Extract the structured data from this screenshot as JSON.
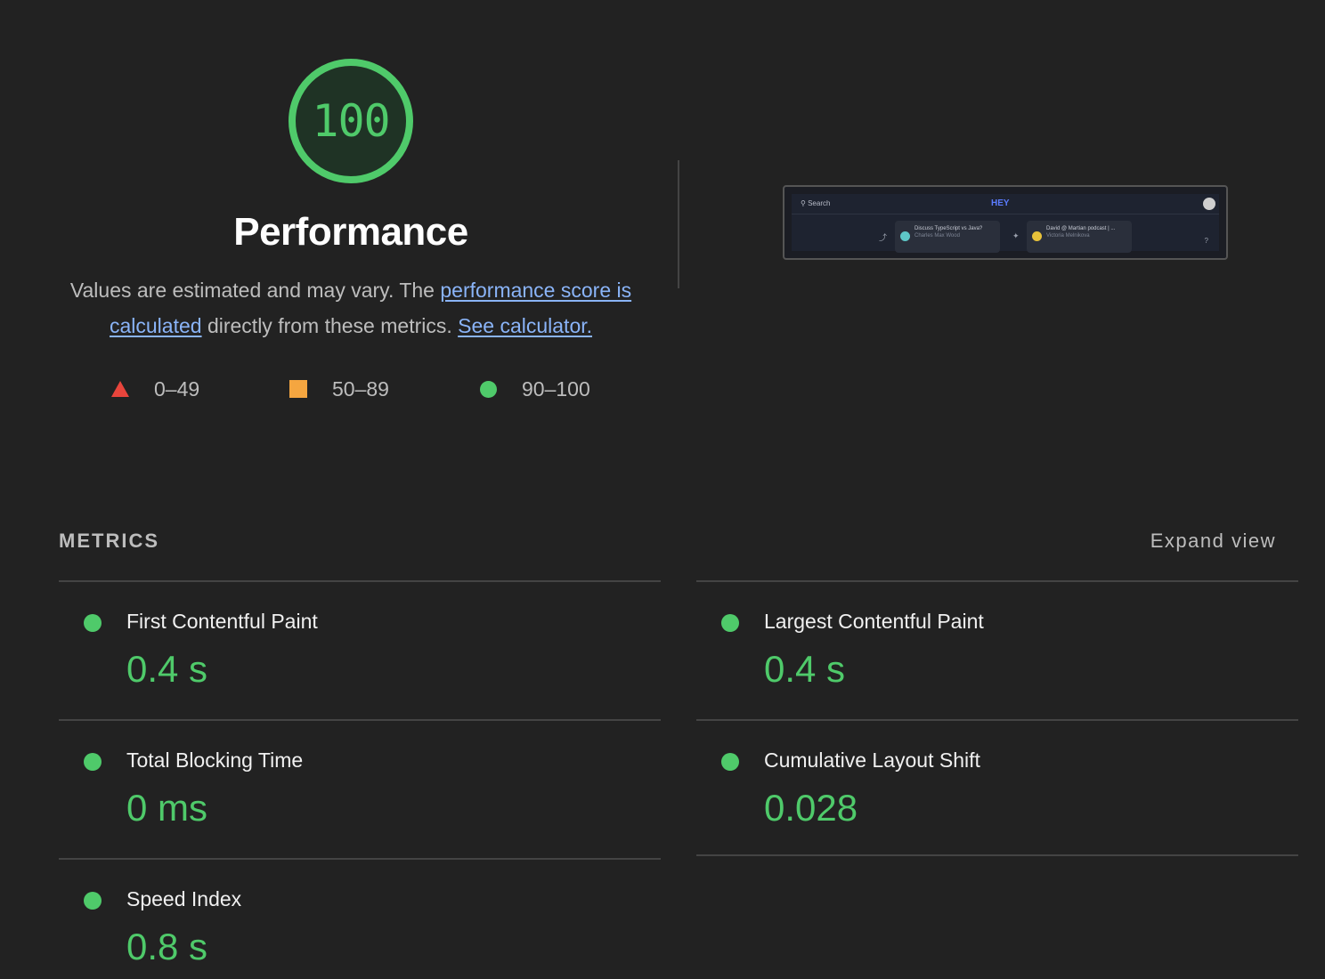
{
  "gauge": {
    "score": "100",
    "score_fraction": 1.0,
    "color": "#4fca6a"
  },
  "category": {
    "title": "Performance"
  },
  "description": {
    "text_1": "Values are estimated and may vary. The ",
    "link_1": "performance score is calculated",
    "text_2": " directly from these metrics. ",
    "link_2": "See calculator."
  },
  "legend": [
    {
      "range": "0–49",
      "shape": "triangle",
      "color": "#e8453c"
    },
    {
      "range": "50–89",
      "shape": "square",
      "color": "#f5a640"
    },
    {
      "range": "90–100",
      "shape": "circle",
      "color": "#4fca6a"
    }
  ],
  "thumbnail": {
    "search_label": "Search",
    "logo": "HEY",
    "card_1_title": "Discuss TypeScript vs Java?",
    "card_1_sub": "Charles Max Wood",
    "card_2_title": "David @ Martian podcast | ...",
    "card_2_sub": "Victoria Melnikova",
    "help": "?"
  },
  "metrics": {
    "header": "METRICS",
    "expand_label": "Expand view",
    "items": [
      {
        "title": "First Contentful Paint",
        "value": "0.4 s",
        "status": "pass"
      },
      {
        "title": "Largest Contentful Paint",
        "value": "0.4 s",
        "status": "pass"
      },
      {
        "title": "Total Blocking Time",
        "value": "0 ms",
        "status": "pass"
      },
      {
        "title": "Cumulative Layout Shift",
        "value": "0.028",
        "status": "pass"
      },
      {
        "title": "Speed Index",
        "value": "0.8 s",
        "status": "pass"
      }
    ]
  }
}
